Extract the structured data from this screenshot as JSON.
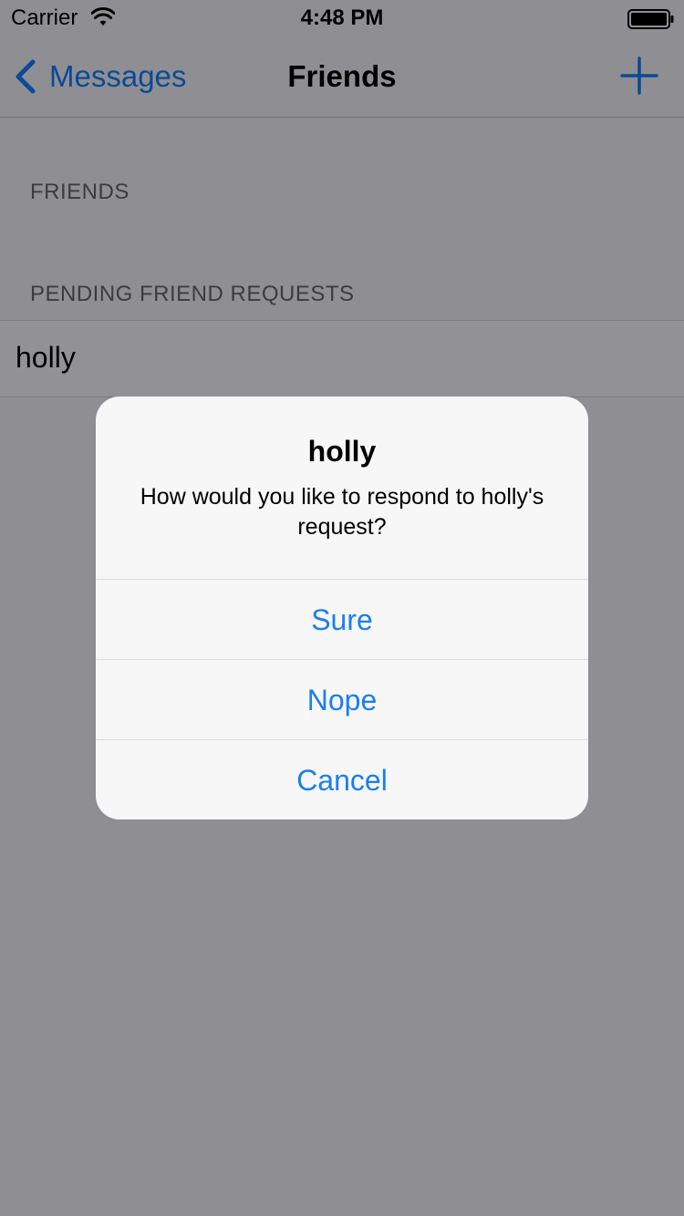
{
  "status_bar": {
    "carrier": "Carrier",
    "time": "4:48 PM",
    "wifi_icon": "wifi-icon",
    "battery_icon": "battery-icon"
  },
  "nav": {
    "back_label": "Messages",
    "back_icon": "chevron-left-icon",
    "title": "Friends",
    "add_icon": "plus-icon"
  },
  "table": {
    "friends_header": "FRIENDS",
    "pending_header": "PENDING FRIEND REQUESTS",
    "pending_rows": [
      "holly"
    ]
  },
  "alert": {
    "title": "holly",
    "message": "How would you like to respond to holly's request?",
    "actions": [
      "Sure",
      "Nope",
      "Cancel"
    ]
  },
  "colors": {
    "accent": "#1a7ff0",
    "nav_tint_dimmed": "#0a4a96",
    "dimmed_background": "#8f8f93",
    "alert_background": "#f7f7f7"
  }
}
